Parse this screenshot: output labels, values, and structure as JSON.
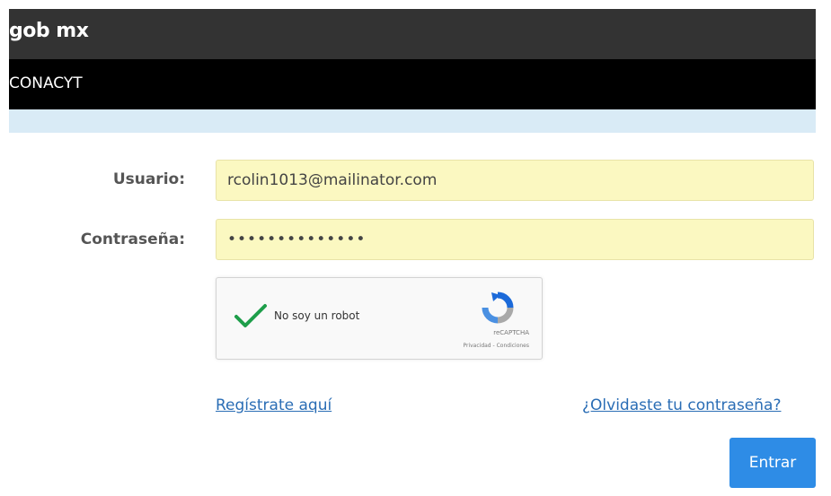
{
  "header": {
    "brand": "gob mx",
    "org": "CONACYT"
  },
  "login": {
    "username_label": "Usuario:",
    "username_value": "rcolin1013@mailinator.com",
    "password_label": "Contraseña:",
    "password_value": "••••••••••••••"
  },
  "captcha": {
    "label": "No soy un robot",
    "name": "reCAPTCHA",
    "terms": "Privacidad - Condiciones",
    "checked": true
  },
  "links": {
    "register": "Regístrate aquí",
    "forgot": "¿Olvidaste tu contraseña?"
  },
  "actions": {
    "submit": "Entrar"
  },
  "colors": {
    "topbar": "#333333",
    "subbar": "#000000",
    "stripe": "#d9ebf6",
    "field_bg": "#fbf8c1",
    "link": "#2a6db5",
    "button": "#2e8ce6",
    "checkmark": "#1e9e4a"
  }
}
